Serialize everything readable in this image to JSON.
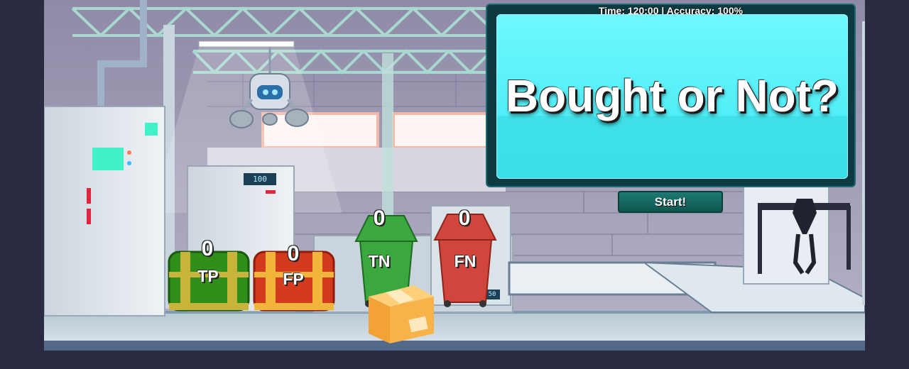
{
  "hud": {
    "status": "Time: 120:00 | Accuracy: 100%",
    "title": "Bought or Not?"
  },
  "start_button": {
    "label": "Start!"
  },
  "bins": [
    {
      "label": "TP",
      "count": "0",
      "type": "chest",
      "color": "#2f8f1a"
    },
    {
      "label": "FP",
      "count": "0",
      "type": "chest",
      "color": "#d43a1e"
    },
    {
      "label": "TN",
      "count": "0",
      "type": "trash-can",
      "color": "#3aa83e"
    },
    {
      "label": "FN",
      "count": "0",
      "type": "trash-can",
      "color": "#d0463c"
    }
  ],
  "scene": {
    "machine_display": "100",
    "small_display": "50"
  },
  "colors": {
    "accent": "#52eef7",
    "button": "#1d7a74"
  }
}
